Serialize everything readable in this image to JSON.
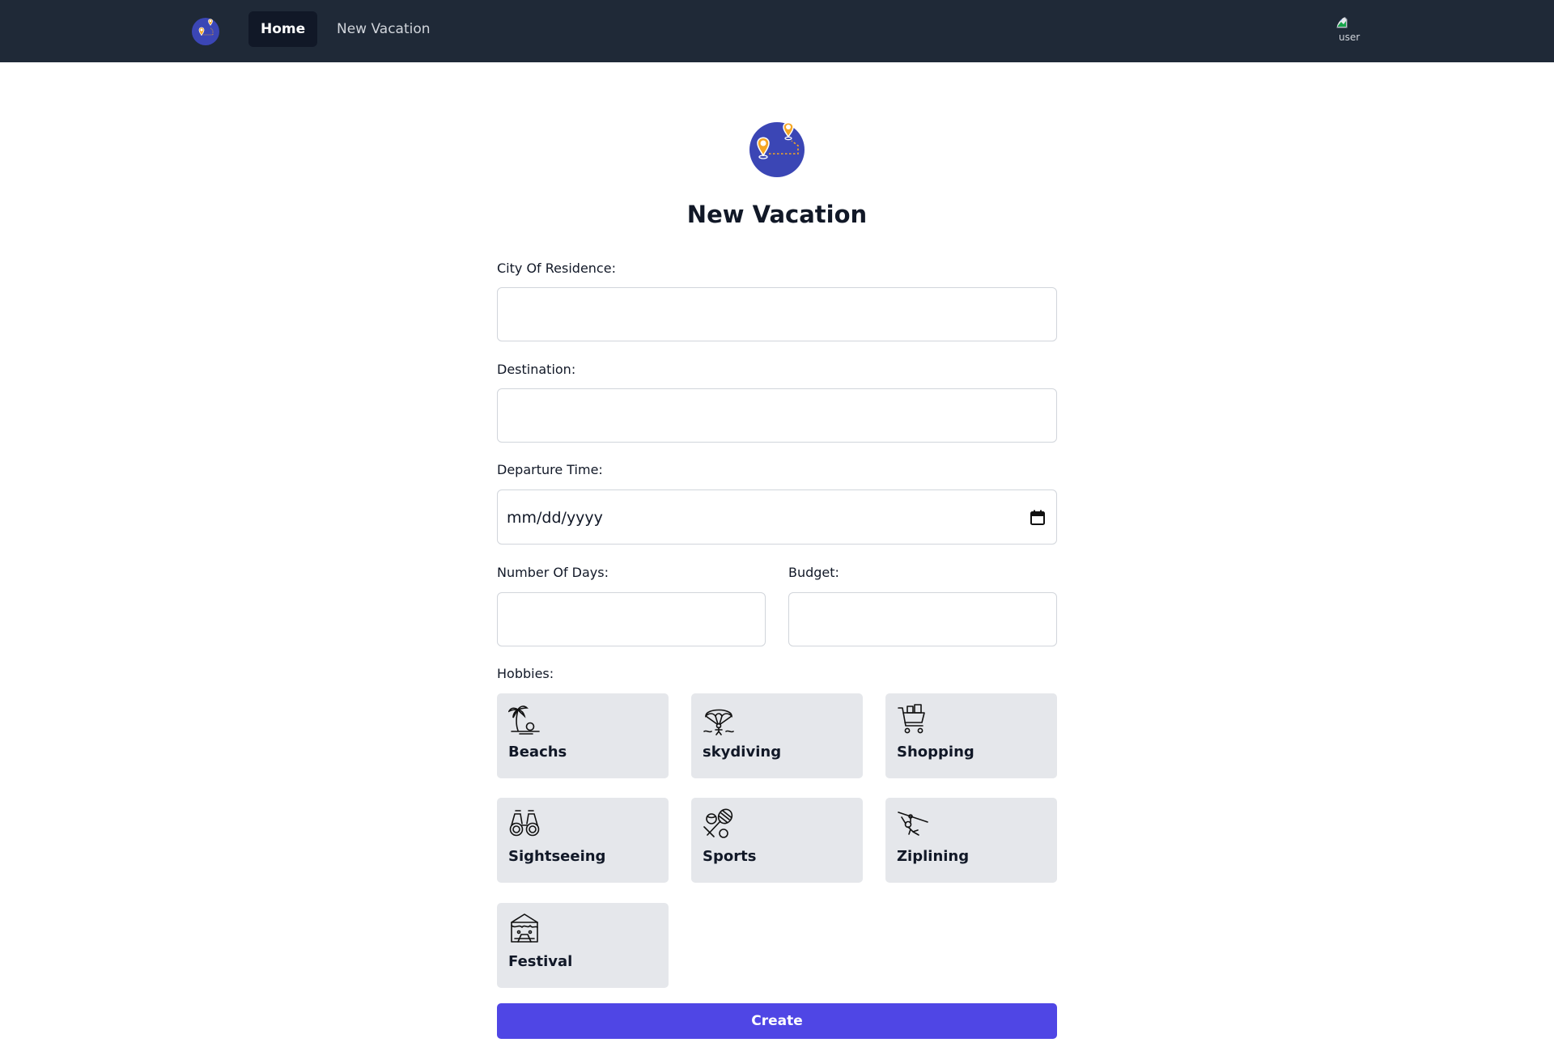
{
  "navbar": {
    "logo_icon": "travel-map-pins-logo",
    "links": [
      {
        "label": "Home",
        "active": true
      },
      {
        "label": "New Vacation",
        "active": false
      }
    ],
    "avatar_alt": "user",
    "background": "#1f2937"
  },
  "header": {
    "logo_icon": "travel-map-pins-logo",
    "title": "New Vacation"
  },
  "form": {
    "city_of_residence": {
      "label": "City Of Residence:",
      "value": ""
    },
    "destination": {
      "label": "Destination:",
      "value": ""
    },
    "departure_time": {
      "label": "Departure Time:",
      "placeholder": "mm/dd/yyyy"
    },
    "number_of_days": {
      "label": "Number Of Days:",
      "value": ""
    },
    "budget": {
      "label": "Budget:",
      "value": ""
    },
    "hobbies": {
      "label": "Hobbies:",
      "items": [
        {
          "label": "Beachs",
          "icon": "palm-tree-beach-icon"
        },
        {
          "label": "skydiving",
          "icon": "parachute-icon"
        },
        {
          "label": "Shopping",
          "icon": "shopping-cart-icon"
        },
        {
          "label": "Sightseeing",
          "icon": "binoculars-icon"
        },
        {
          "label": "Sports",
          "icon": "sports-rackets-icon"
        },
        {
          "label": "Ziplining",
          "icon": "zipline-icon"
        },
        {
          "label": "Festival",
          "icon": "festival-stage-icon"
        }
      ]
    },
    "submit_label": "Create"
  },
  "colors": {
    "accent": "#4f46e5",
    "logo_circle": "#3b46b5",
    "logo_pin": "#f5a623",
    "hobby_card": "#e5e7eb"
  }
}
